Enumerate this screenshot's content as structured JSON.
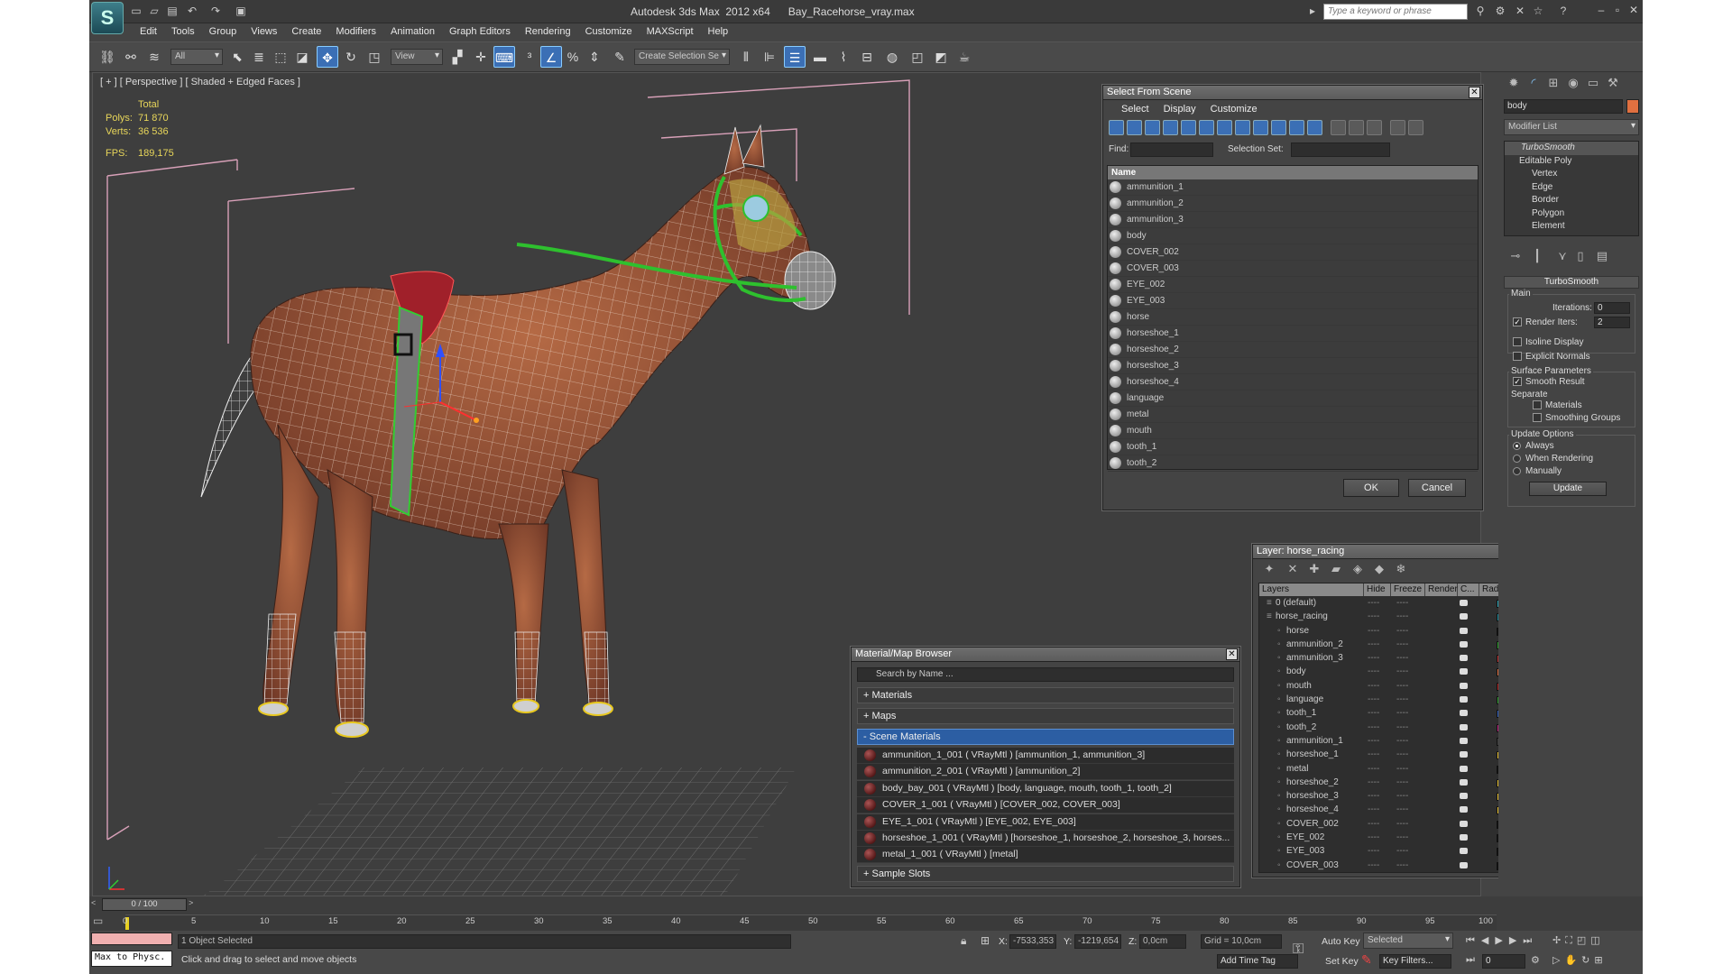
{
  "app": {
    "title": "Autodesk 3ds Max  2012 x64      Bay_Racehorse_vray.max",
    "search_placeholder": "Type a keyword or phrase"
  },
  "menu": [
    "Edit",
    "Tools",
    "Group",
    "Views",
    "Create",
    "Modifiers",
    "Animation",
    "Graph Editors",
    "Rendering",
    "Customize",
    "MAXScript",
    "Help"
  ],
  "toolbar": {
    "filter": "All",
    "ref_coord": "View",
    "named_selection": "Create Selection Se"
  },
  "viewport": {
    "label": "[ + ] [ Perspective ] [ Shaded + Edged Faces ]",
    "stats": {
      "header": "Total",
      "polys_label": "Polys:",
      "polys": "71 870",
      "verts_label": "Verts:",
      "verts": "36 536",
      "fps_label": "FPS:",
      "fps": "189,175"
    }
  },
  "select_from_scene": {
    "title": "Select From Scene",
    "menu": [
      "Select",
      "Display",
      "Customize"
    ],
    "find_label": "Find:",
    "selection_set_label": "Selection Set:",
    "column_name": "Name",
    "objects": [
      "ammunition_1",
      "ammunition_2",
      "ammunition_3",
      "body",
      "COVER_002",
      "COVER_003",
      "EYE_002",
      "EYE_003",
      "horse",
      "horseshoe_1",
      "horseshoe_2",
      "horseshoe_3",
      "horseshoe_4",
      "language",
      "metal",
      "mouth",
      "tooth_1",
      "tooth_2"
    ],
    "ok": "OK",
    "cancel": "Cancel"
  },
  "material_browser": {
    "title": "Material/Map Browser",
    "search": "Search by Name ...",
    "materials_rollout": "+ Materials",
    "maps_rollout": "+ Maps",
    "scene_materials_rollout": "- Scene Materials",
    "scene_materials": [
      "ammunition_1_001  ( VRayMtl ) [ammunition_1, ammunition_3]",
      "ammunition_2_001  ( VRayMtl ) [ammunition_2]",
      "body_bay_001  ( VRayMtl ) [body, language, mouth, tooth_1, tooth_2]",
      "COVER_1_001  ( VRayMtl ) [COVER_002, COVER_003]",
      "EYE_1_001  ( VRayMtl ) [EYE_002, EYE_003]",
      "horseshoe_1_001  ( VRayMtl ) [horseshoe_1, horseshoe_2, horseshoe_3, horses...",
      "metal_1_001  ( VRayMtl ) [metal]"
    ],
    "sample_slots_rollout": "+ Sample Slots"
  },
  "layer_panel": {
    "title": "Layer: horse_racing",
    "columns": [
      "Layers",
      "Hide",
      "Freeze",
      "Render",
      "C...",
      "Radiosity"
    ],
    "layers": [
      {
        "name": "0 (default)",
        "color": "#2aa6b8",
        "level": 0
      },
      {
        "name": "horse_racing",
        "color": "#1a8a9a",
        "level": 0
      },
      {
        "name": "horse",
        "color": "#111111",
        "level": 1
      },
      {
        "name": "ammunition_2",
        "color": "#2aa02a",
        "level": 1
      },
      {
        "name": "ammunition_3",
        "color": "#c03030",
        "level": 1
      },
      {
        "name": "body",
        "color": "#e07040",
        "level": 1
      },
      {
        "name": "mouth",
        "color": "#b02020",
        "level": 1
      },
      {
        "name": "language",
        "color": "#30a030",
        "level": 1
      },
      {
        "name": "tooth_1",
        "color": "#3060c0",
        "level": 1
      },
      {
        "name": "tooth_2",
        "color": "#c02080",
        "level": 1
      },
      {
        "name": "ammunition_1",
        "color": "#404040",
        "level": 1
      },
      {
        "name": "horseshoe_1",
        "color": "#e8c030",
        "level": 1
      },
      {
        "name": "metal",
        "color": "#111111",
        "level": 1
      },
      {
        "name": "horseshoe_2",
        "color": "#e8c030",
        "level": 1
      },
      {
        "name": "horseshoe_3",
        "color": "#e8c030",
        "level": 1
      },
      {
        "name": "horseshoe_4",
        "color": "#e8c030",
        "level": 1
      },
      {
        "name": "COVER_002",
        "color": "#111111",
        "level": 1
      },
      {
        "name": "EYE_002",
        "color": "#111111",
        "level": 1
      },
      {
        "name": "EYE_003",
        "color": "#111111",
        "level": 1
      },
      {
        "name": "COVER_003",
        "color": "#111111",
        "level": 1
      }
    ]
  },
  "command_panel": {
    "object_name": "body",
    "object_color": "#e07040",
    "modifier_list": "Modifier List",
    "stack": [
      "TurboSmooth",
      "Editable Poly",
      "Vertex",
      "Edge",
      "Border",
      "Polygon",
      "Element"
    ],
    "rollout_title": "TurboSmooth",
    "main_label": "Main",
    "iterations_label": "Iterations:",
    "iterations": "0",
    "render_iters_label": "Render Iters:",
    "render_iters": "2",
    "isoline": "Isoline Display",
    "explicit_normals": "Explicit Normals",
    "surface_params": "Surface Parameters",
    "smooth_result": "Smooth Result",
    "separate": "Separate",
    "materials": "Materials",
    "smoothing_groups": "Smoothing Groups",
    "update_options": "Update Options",
    "always": "Always",
    "when_rendering": "When Rendering",
    "manually": "Manually",
    "update": "Update"
  },
  "timeline": {
    "frame": "0 / 100",
    "ticks": [
      "0",
      "5",
      "10",
      "15",
      "20",
      "25",
      "30",
      "35",
      "40",
      "45",
      "50",
      "55",
      "60",
      "65",
      "70",
      "75",
      "80",
      "85",
      "90",
      "95",
      "100"
    ]
  },
  "status": {
    "maxscript": "Max to Physc.",
    "selected": "1 Object Selected",
    "prompt": "Click and drag to select and move objects",
    "x_label": "X:",
    "x": "-7533,353",
    "y_label": "Y:",
    "y": "-1219,654",
    "z_label": "Z:",
    "z": "0,0cm",
    "grid": "Grid = 10,0cm",
    "auto_key": "Auto Key",
    "key_mode": "Selected",
    "set_key": "Set Key",
    "key_filters": "Key Filters...",
    "add_time_tag": "Add Time Tag",
    "frame_field": "0"
  }
}
